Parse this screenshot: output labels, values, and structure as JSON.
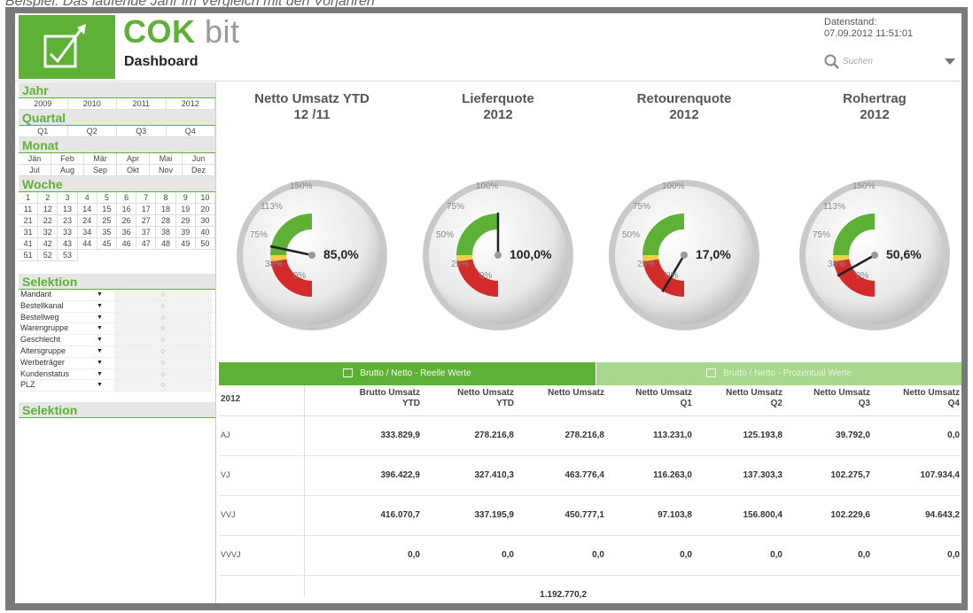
{
  "caption": "Beispiel: Das laufende Jahr im Vergleich mit den Vorjahren",
  "header": {
    "brand_main": "COK",
    "brand_suffix": " bit",
    "subtitle": "Dashboard",
    "datenstand_label": "Datenstand:",
    "datenstand_value": "07.09.2012 11:51:01",
    "search_placeholder": "Suchen"
  },
  "sidebar": {
    "jahr": {
      "title": "Jahr",
      "items": [
        "2009",
        "2010",
        "2011",
        "2012"
      ]
    },
    "quartal": {
      "title": "Quartal",
      "items": [
        "Q1",
        "Q2",
        "Q3",
        "Q4"
      ]
    },
    "monat": {
      "title": "Monat",
      "items": [
        "Jän",
        "Feb",
        "Mär",
        "Apr",
        "Mai",
        "Jun",
        "Jul",
        "Aug",
        "Sep",
        "Okt",
        "Nov",
        "Dez"
      ]
    },
    "woche": {
      "title": "Woche",
      "items": [
        "1",
        "2",
        "3",
        "4",
        "5",
        "6",
        "7",
        "8",
        "9",
        "10",
        "11",
        "12",
        "13",
        "14",
        "15",
        "16",
        "17",
        "18",
        "19",
        "20",
        "21",
        "22",
        "23",
        "24",
        "25",
        "26",
        "27",
        "28",
        "29",
        "30",
        "31",
        "32",
        "33",
        "34",
        "35",
        "36",
        "37",
        "38",
        "39",
        "40",
        "41",
        "42",
        "43",
        "44",
        "45",
        "46",
        "47",
        "48",
        "49",
        "50",
        "51",
        "52",
        "53"
      ]
    },
    "selektion": {
      "title": "Selektion",
      "rows": [
        {
          "name": "Mandant",
          "value": "○"
        },
        {
          "name": "Bestellkanal",
          "value": "○"
        },
        {
          "name": "Bestellweg",
          "value": "○"
        },
        {
          "name": "Warengruppe",
          "value": "○"
        },
        {
          "name": "Geschlecht",
          "value": "○"
        },
        {
          "name": "Altersgruppe",
          "value": "○"
        },
        {
          "name": "Werbeträger",
          "value": "○"
        },
        {
          "name": "Kundenstatus",
          "value": "○"
        },
        {
          "name": "PLZ",
          "value": "○"
        }
      ]
    },
    "selektion2": {
      "title": "Selektion"
    }
  },
  "gauges": [
    {
      "title1": "Netto Umsatz YTD",
      "title2": "12 /11",
      "value_text": "85,0%",
      "ticks": [
        "150%",
        "113%",
        "75%",
        "38%",
        "0%"
      ],
      "value": 0.85,
      "max": 1.5
    },
    {
      "title1": "Lieferquote",
      "title2": "2012",
      "value_text": "100,0%",
      "ticks": [
        "100%",
        "75%",
        "50%",
        "25%",
        "0%"
      ],
      "value": 1.0,
      "max": 1.0
    },
    {
      "title1": "Retourenquote",
      "title2": "2012",
      "value_text": "17,0%",
      "ticks": [
        "100%",
        "75%",
        "50%",
        "25%",
        "0%"
      ],
      "value": 0.17,
      "max": 1.0
    },
    {
      "title1": "Rohertrag",
      "title2": "2012",
      "value_text": "50,6%",
      "ticks": [
        "150%",
        "113%",
        "75%",
        "38%",
        "0%"
      ],
      "value": 0.506,
      "max": 1.5
    }
  ],
  "tabs": {
    "tab1": "Brutto / Netto - Reelle Werte",
    "tab2": "Brutto / Netto - Prozentual Werte"
  },
  "table": {
    "first_header": "2012",
    "headers": [
      [
        "Brutto Umsatz",
        "YTD"
      ],
      [
        "Netto Umsatz",
        "YTD"
      ],
      [
        "Netto Umsatz",
        ""
      ],
      [
        "Netto Umsatz",
        "Q1"
      ],
      [
        "Netto Umsatz",
        "Q2"
      ],
      [
        "Netto Umsatz",
        "Q3"
      ],
      [
        "Netto Umsatz",
        "Q4"
      ]
    ],
    "rows": [
      {
        "label": "AJ",
        "values": [
          "333.829,9",
          "278.216,8",
          "278.216,8",
          "113.231,0",
          "125.193,8",
          "39.792,0",
          "0,0"
        ]
      },
      {
        "label": "VJ",
        "values": [
          "396.422,9",
          "327.410,3",
          "463.776,4",
          "116.263,0",
          "137.303,3",
          "102.275,7",
          "107.934,4"
        ]
      },
      {
        "label": "VVJ",
        "values": [
          "416.070,7",
          "337.195,9",
          "450.777,1",
          "97.103,8",
          "156.800,4",
          "102.229,6",
          "94.643,2"
        ]
      },
      {
        "label": "VVVJ",
        "values": [
          "0,0",
          "0,0",
          "0,0",
          "0,0",
          "0,0",
          "0,0",
          "0,0"
        ]
      }
    ],
    "total": "1.192.770,2"
  },
  "colors": {
    "accent": "#5db135",
    "accent_light": "#a8d88e",
    "gauge_red": "#d42a2a",
    "gauge_green": "#5db135",
    "gauge_yellow": "#f0d040"
  }
}
